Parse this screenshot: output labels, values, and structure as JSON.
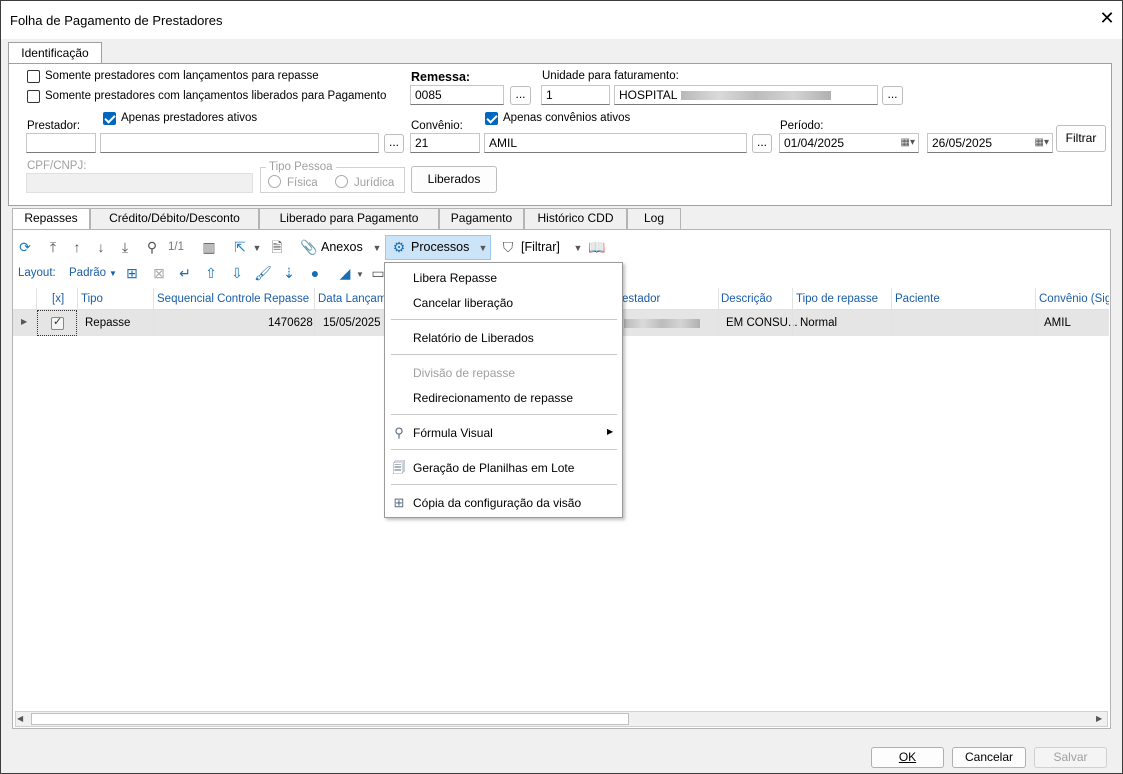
{
  "window": {
    "title": "Folha de Pagamento de Prestadores",
    "close_glyph": "✕"
  },
  "main_tab": "Identificação",
  "filters": {
    "chk_repasse": "Somente prestadores com lançamentos para repasse",
    "chk_liberados": "Somente prestadores com lançamentos liberados para Pagamento",
    "remessa_label": "Remessa:",
    "remessa_value": "0085",
    "unidade_label": "Unidade para faturamento:",
    "unidade_code": "1",
    "unidade_name": "HOSPITAL",
    "prestador_label": "Prestador:",
    "apenas_prestadores": "Apenas prestadores ativos",
    "convenio_label": "Convênio:",
    "apenas_convenios": "Apenas convênios ativos",
    "convenio_code": "21",
    "convenio_name": "AMIL",
    "periodo_label": "Período:",
    "periodo_inicio": "01/04/2025",
    "periodo_fim": "26/05/2025",
    "filtrar_button": "Filtrar",
    "cpf_label": "CPF/CNPJ:",
    "tipo_pessoa_label": "Tipo Pessoa",
    "fisica": "Física",
    "juridica": "Jurídica",
    "liberados_button": "Liberados",
    "ellipsis": "..."
  },
  "tabs": [
    "Repasses",
    "Crédito/Débito/Desconto",
    "Liberado para Pagamento",
    "Pagamento",
    "Histórico CDD",
    "Log"
  ],
  "toolbar": {
    "page_indicator": "1/1",
    "anexos": "Anexos",
    "processos": "Processos",
    "filtrar": "[Filtrar]",
    "layout_label": "Layout:",
    "layout_value": "Padrão"
  },
  "grid": {
    "headers": [
      "[x]",
      "Tipo",
      "Sequencial Controle Repasse",
      "Data Lançame",
      "estador",
      "Descrição",
      "Tipo de repasse",
      "Paciente",
      "Convênio (Sigl"
    ],
    "row": {
      "tipo": "Repasse",
      "sequencial": "1470628",
      "data": "15/05/2025",
      "descricao": "EM CONSU...",
      "tipo_repasse": "Normal",
      "convenio": "AMIL"
    }
  },
  "menu": {
    "items": [
      "Libera Repasse",
      "Cancelar liberação",
      "Relatório de Liberados",
      "Divisão de repasse",
      "Redirecionamento de repasse",
      "Fórmula Visual",
      "Geração de Planilhas em Lote",
      "Cópia da configuração da visão"
    ]
  },
  "footer": {
    "ok": "OK",
    "cancelar": "Cancelar",
    "salvar": "Salvar"
  }
}
